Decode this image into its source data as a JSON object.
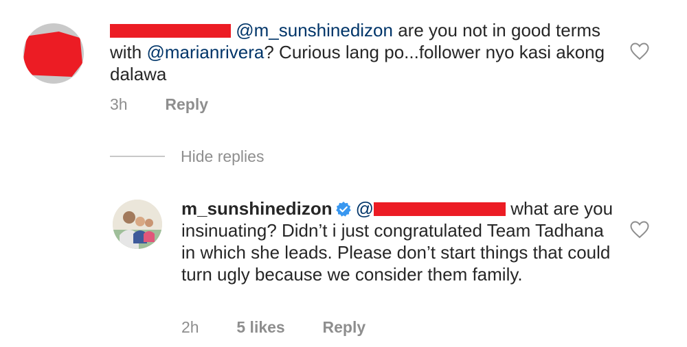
{
  "comment1": {
    "avatar": "redacted-avatar",
    "mention1": "@m_sunshinedizon",
    "text1": " are you not in good terms with ",
    "mention2": "@marianrivera",
    "text2": "?  Curious lang po...follower nyo kasi akong dalawa",
    "time": "3h",
    "reply_label": "Reply",
    "like_icon": "heart-outline-icon"
  },
  "hide_replies_label": "Hide replies",
  "comment2": {
    "username": "m_sunshinedizon",
    "verified_icon": "verified-badge-icon",
    "mention_prefix": "@",
    "text": " what are you insinuating? Didn’t i just congratulated Team Tadhana in which  she leads. Please don’t start things that could turn ugly because we consider them family.",
    "time": "2h",
    "likes": "5 likes",
    "reply_label": "Reply",
    "like_icon": "heart-outline-icon"
  },
  "colors": {
    "text": "#262626",
    "mention": "#003569",
    "meta": "#8e8e8e",
    "redaction": "#ec1c24",
    "verified": "#3897f0"
  }
}
